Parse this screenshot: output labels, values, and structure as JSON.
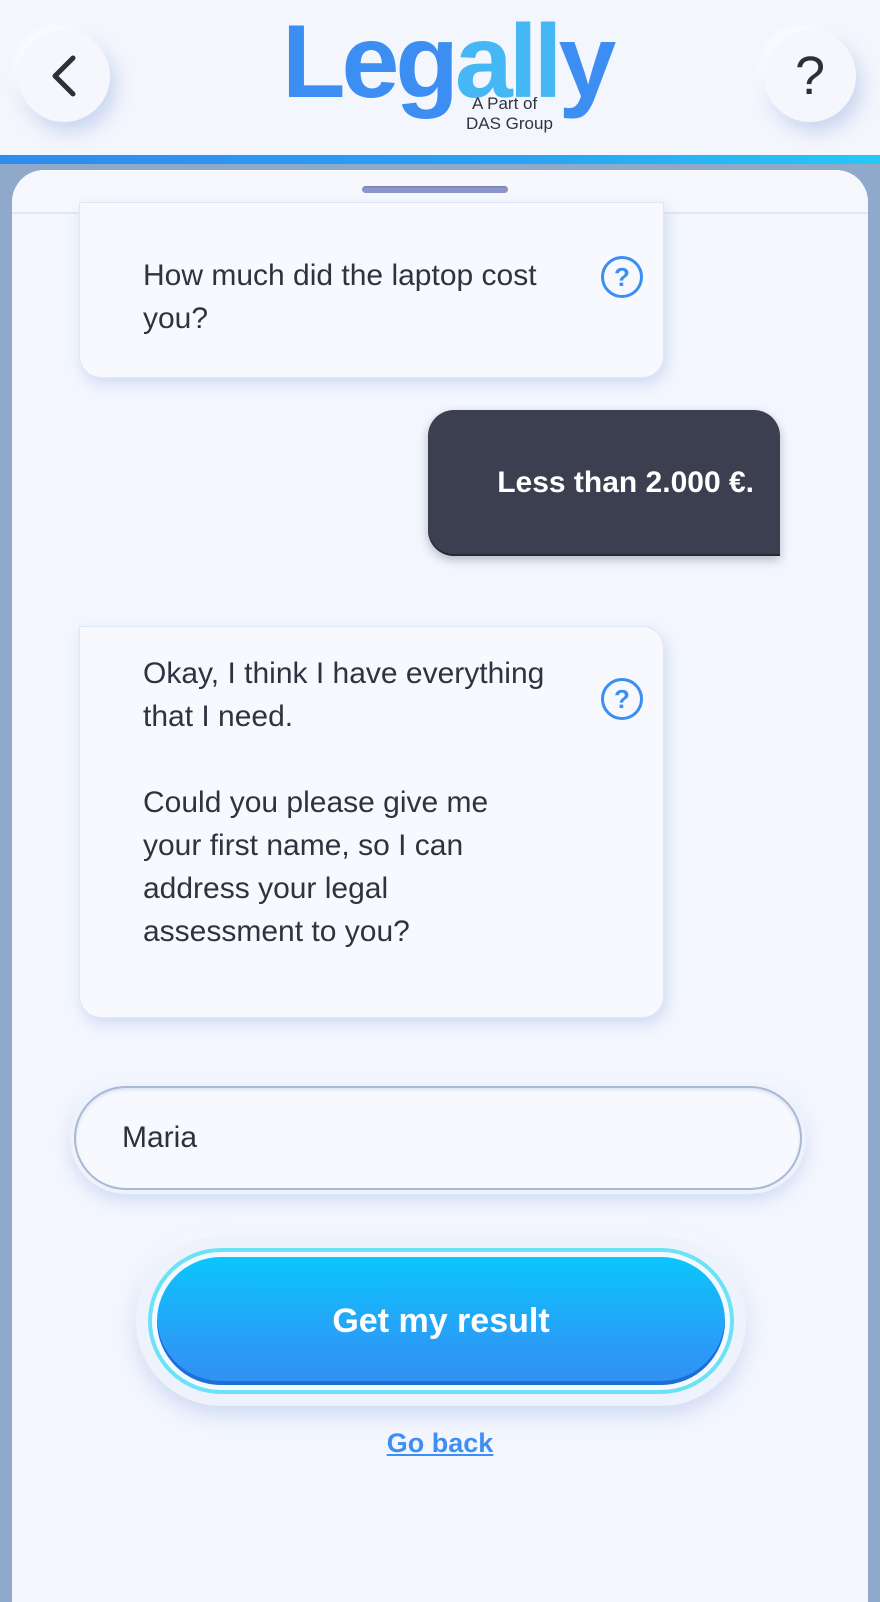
{
  "header": {
    "logo_part1": "Leg",
    "logo_part2": "all",
    "logo_part3": "y",
    "logo_sub_line1": "A Part of",
    "logo_sub_line2": "DAS Group",
    "help_label": "?"
  },
  "chat": {
    "bot_message_1": "How much did the laptop cost you?",
    "user_message_1": "Less than 2.000 €.",
    "bot_message_2_p1": "Okay, I think I have everything that I need.",
    "bot_message_2_p2": "Could you please give me your first name, so I can address your legal assessment to you?",
    "help_icon_glyph": "?"
  },
  "form": {
    "name_value": "Maria",
    "submit_label": "Get my result",
    "go_back_label": "Go back"
  },
  "colors": {
    "accent": "#3b8ff1",
    "user_bubble": "#3c3f50",
    "button_top": "#0bc6fb",
    "button_bottom": "#3290f3"
  }
}
